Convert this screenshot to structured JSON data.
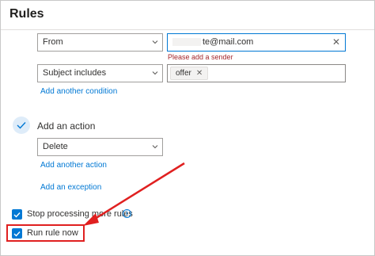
{
  "dialog": {
    "title": "Rules"
  },
  "conditions": [
    {
      "field": "From",
      "value_visible": "te@mail.com",
      "error": "Please add a sender"
    },
    {
      "field": "Subject includes",
      "chip": "offer"
    }
  ],
  "links": {
    "add_condition": "Add another condition",
    "add_action": "Add another action",
    "add_exception": "Add an exception"
  },
  "action": {
    "header": "Add an action",
    "selected": "Delete"
  },
  "options": {
    "stop_processing": {
      "label": "Stop processing more rules",
      "checked": true
    },
    "run_rule_now": {
      "label": "Run rule now",
      "checked": true
    }
  },
  "icons": {
    "chevron": "chevron-down-icon",
    "clear": "clear-icon",
    "check": "checkmark-icon",
    "info": "info-icon"
  },
  "colors": {
    "accent": "#0078d4",
    "error": "#a4262c",
    "annotation": "#e02020"
  }
}
